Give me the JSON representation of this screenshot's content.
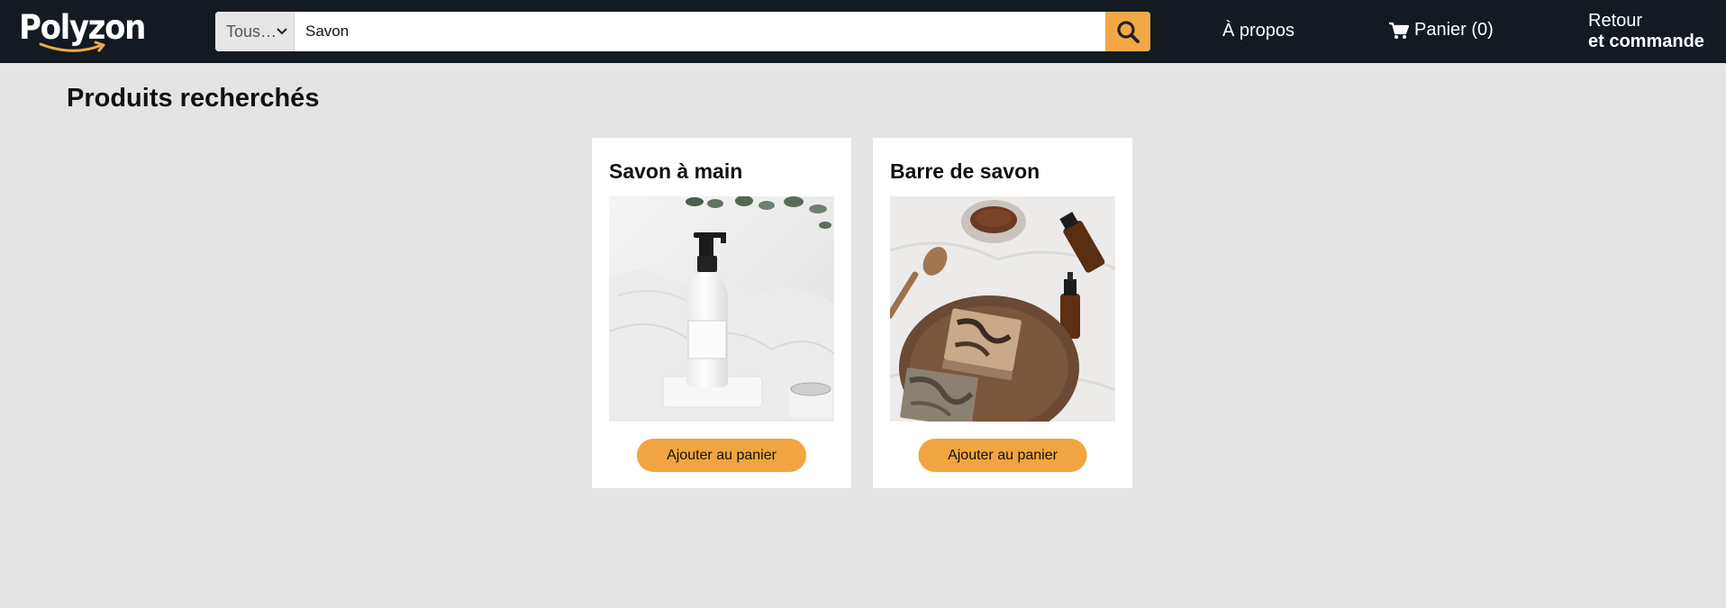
{
  "header": {
    "logo_text": "Polyzon",
    "search": {
      "category": "Tous…",
      "value": "Savon",
      "search_icon": "search-icon"
    },
    "nav": {
      "about": "À propos",
      "cart_label": "Panier (0)",
      "cart_icon": "cart-icon",
      "orders_line1": "Retour",
      "orders_line2": "et commande"
    }
  },
  "main": {
    "title": "Produits recherchés",
    "products": [
      {
        "name": "Savon à main",
        "button": "Ajouter au panier",
        "image": "hand-soap-pump-bottle-photo"
      },
      {
        "name": "Barre de savon",
        "button": "Ajouter au panier",
        "image": "soap-bars-on-wooden-tray-photo"
      }
    ]
  },
  "colors": {
    "navbar": "#131a22",
    "accent": "#f3a847",
    "button": "#f0a540",
    "page_bg": "#e3e4e3"
  }
}
